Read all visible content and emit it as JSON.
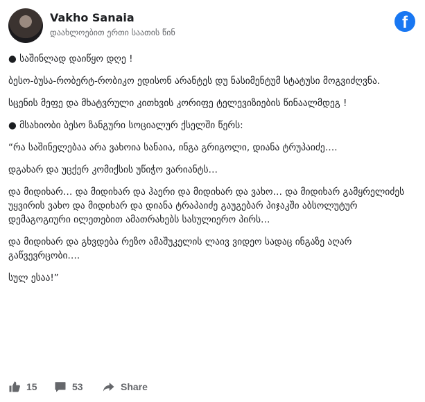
{
  "post": {
    "author": "Vakho Sanaia",
    "timestamp": "დაახლოებით ერთი საათის წინ",
    "paragraphs": [
      "● საშინლად დაიწყო დღე !",
      "ბესო-ბუსა-რობერტ-რობიკო ედისონ არანტეს დუ ნასიმენტუმ სტატუსი მოგვიძღვნა.",
      "სცენის მეფე და მხატვრული კითხვის კორიფე ტელევიზიების წინაალმდეგ !",
      "● მსახიობი ბესო ზანგური სოციალურ ქსელში წერს:",
      "“რა საშინელებაა არა ვახოია სანაია, ინგა გრიგოლი, დიანა ტრუპაიძე….",
      "დგახარ და უცქერ კომიქსის უწიჭო ვარიანტს…",
      "და მიდიხარ… და მიდიხარ და ჰაერი და მიდიხარ და ვახო… და მიდიხარ გამყრელიძეს უყვირის ვახო და მიდიხარ და დიანა ტრაპაიძე გაუგებარ პიჯაკში აბსოლუტურ დემაგოგიური ილეთებით ამათრახებს სასულიერო პირს…",
      "და მიდიხარ და გხვდება რეზო ამაშუკელის ლაივ ვიდეო სადაც ინგაზე აღარ გაწვევრცობი….",
      "სულ ესაა!”"
    ]
  },
  "footer": {
    "likes": "15",
    "comments": "53",
    "share_label": "Share"
  },
  "icons": {
    "logo": "facebook-logo-icon",
    "like": "thumbs-up-icon",
    "comment": "comment-bubble-icon",
    "share": "share-arrow-icon"
  },
  "colors": {
    "brand": "#1877f2",
    "muted": "#65676b"
  }
}
